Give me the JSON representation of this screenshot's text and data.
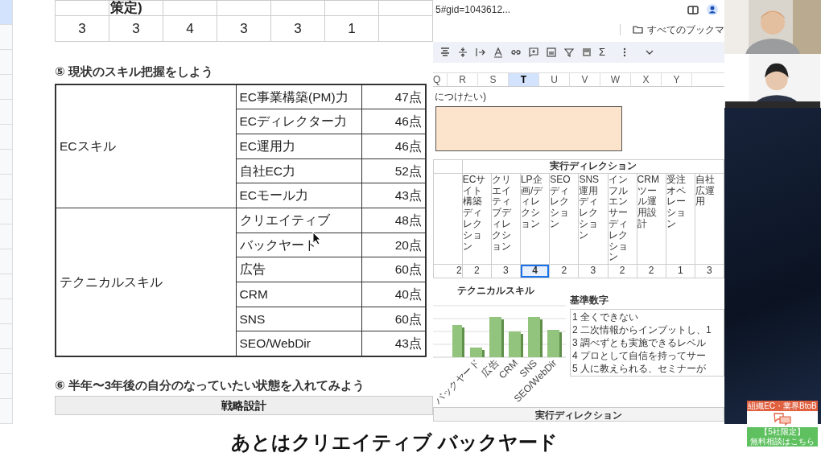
{
  "document": {
    "top_table": {
      "header_fragment": "策定)",
      "values": [
        "3",
        "3",
        "4",
        "3",
        "3",
        "1"
      ]
    },
    "section5_title": "⑤ 現状のスキル把握をしよう",
    "skill_groups": [
      {
        "name": "ECスキル",
        "skills": [
          {
            "name": "EC事業構築(PM)力",
            "score": "47点"
          },
          {
            "name": "ECディレクター力",
            "score": "46点"
          },
          {
            "name": "EC運用力",
            "score": "46点"
          },
          {
            "name": "自社EC力",
            "score": "52点"
          },
          {
            "name": "ECモール力",
            "score": "43点"
          }
        ]
      },
      {
        "name": "テクニカルスキル",
        "skills": [
          {
            "name": "クリエイティブ",
            "score": "48点"
          },
          {
            "name": "バックヤード",
            "score": "20点"
          },
          {
            "name": "広告",
            "score": "60点"
          },
          {
            "name": "CRM",
            "score": "40点"
          },
          {
            "name": "SNS",
            "score": "60点"
          },
          {
            "name": "SEO/WebDir",
            "score": "43点"
          }
        ]
      }
    ],
    "section6_title": "⑥ 半年〜3年後の自分のなっていたい状態を入れてみよう",
    "next_table_header": "戦略設計"
  },
  "browser": {
    "address": "5#gid=1043612...",
    "bookmarks_folder": "すべてのブックマ",
    "toolbar_sigma": "Σ",
    "columns": [
      {
        "label": "Q",
        "selected": false
      },
      {
        "label": "R",
        "selected": false
      },
      {
        "label": "S",
        "selected": false
      },
      {
        "label": "T",
        "selected": true
      },
      {
        "label": "U",
        "selected": false
      },
      {
        "label": "V",
        "selected": false
      },
      {
        "label": "W",
        "selected": false
      },
      {
        "label": "X",
        "selected": false
      },
      {
        "label": "Y",
        "selected": false
      }
    ],
    "note_fragment": "につけたい)",
    "direction_table": {
      "group_header": "実行ディレクション",
      "cells": [
        {
          "value": "2",
          "selected": false
        },
        {
          "header": "ECサイト構築ディレクション",
          "value": "2",
          "selected": false
        },
        {
          "header": "クリエイティブディレクション",
          "value": "3",
          "selected": false
        },
        {
          "header": "LP企画/ディレクション",
          "value": "4",
          "selected": true
        },
        {
          "header": "SEOディレクション",
          "value": "2",
          "selected": false
        },
        {
          "header": "SNS運用ディレクション",
          "value": "3",
          "selected": false
        },
        {
          "header": "インフルエンサーディレクション",
          "value": "2",
          "selected": false
        },
        {
          "header": "CRMツール運用設計",
          "value": "2",
          "selected": false
        },
        {
          "header": "受注オペレーション",
          "value": "1",
          "selected": false
        },
        {
          "header": "自社広運用",
          "value": "3",
          "selected": false
        }
      ]
    },
    "chart_title": "テクニカルスキル",
    "chart_labels": [
      "バックヤード",
      "広告",
      "CRM",
      "SNS",
      "SEO/WebDir"
    ],
    "legend": {
      "title": "基準数字",
      "items": [
        "1 全くできない",
        "2 二次情報からインプットし、1",
        "3 調べずとも実施できるレベル",
        "4 プロとして自信を持ってサー",
        "5 人に教えられる、セミナーが"
      ]
    },
    "bottom_group_header": "実行ディレクション"
  },
  "ad_banner": {
    "top": "組織EC・業界BtoB",
    "bottom": [
      "【5社限定】",
      "無料相談はこちら"
    ]
  },
  "subtitle": "あとはクリエイティブ バックヤード"
}
